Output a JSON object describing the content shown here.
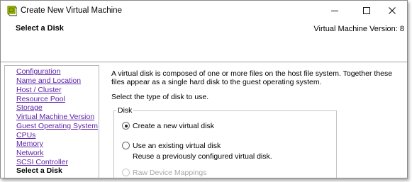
{
  "window": {
    "title": "Create New Virtual Machine",
    "app_icon": "vsphere-logo-icon",
    "controls": {
      "minimize": "minimize-icon",
      "maximize": "maximize-icon",
      "close": "close-icon"
    }
  },
  "header": {
    "title": "Select a Disk",
    "version": "Virtual Machine Version: 8"
  },
  "nav": {
    "items": [
      {
        "label": "Configuration"
      },
      {
        "label": "Name and Location"
      },
      {
        "label": "Host / Cluster"
      },
      {
        "label": "Resource Pool"
      },
      {
        "label": "Storage"
      },
      {
        "label": "Virtual Machine Version"
      },
      {
        "label": "Guest Operating System"
      },
      {
        "label": "CPUs"
      },
      {
        "label": "Memory"
      },
      {
        "label": "Network"
      },
      {
        "label": "SCSI Controller"
      },
      {
        "label": "Select a Disk"
      }
    ],
    "current_index": 11
  },
  "content": {
    "description": "A virtual disk is composed of one or more files on the host file system. Together these files appear as a single hard disk to the guest operating system.",
    "prompt": "Select the type of disk to use.",
    "group_label": "Disk",
    "options": [
      {
        "label": "Create a new virtual disk",
        "selected": true,
        "enabled": true
      },
      {
        "label": "Use an existing virtual disk",
        "sublabel": "Reuse a previously configured virtual disk.",
        "selected": false,
        "enabled": true
      },
      {
        "label": "Raw Device Mappings",
        "selected": false,
        "enabled": false
      }
    ]
  }
}
